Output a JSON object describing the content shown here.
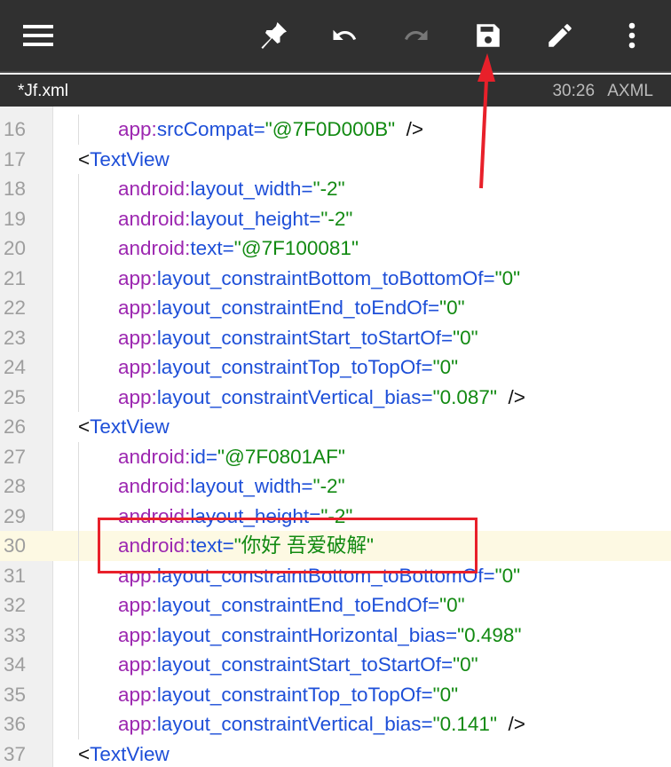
{
  "toolbar": {
    "icons": [
      "menu-icon",
      "pin-icon",
      "undo-icon",
      "redo-icon",
      "save-icon",
      "edit-icon",
      "more-vert-icon"
    ],
    "redo_enabled": false
  },
  "tab": {
    "name": "*Jf.xml",
    "cursor": "30:26",
    "mode": "AXML"
  },
  "colors": {
    "toolbar": "#303030",
    "prefix": "#9c27b0",
    "name": "#1e4fd8",
    "value": "#128a12",
    "highlight": "#fdf9e3",
    "annotation": "#e8202a"
  },
  "lines": [
    {
      "n": "16",
      "t": "attr",
      "p": "app",
      "a": "srcCompat",
      "v": "@7F0D000B",
      "close": true
    },
    {
      "n": "17",
      "t": "tag",
      "tag": "TextView"
    },
    {
      "n": "18",
      "t": "attr",
      "p": "android",
      "a": "layout_width",
      "v": "-2"
    },
    {
      "n": "19",
      "t": "attr",
      "p": "android",
      "a": "layout_height",
      "v": "-2"
    },
    {
      "n": "20",
      "t": "attr",
      "p": "android",
      "a": "text",
      "v": "@7F100081"
    },
    {
      "n": "21",
      "t": "attr",
      "p": "app",
      "a": "layout_constraintBottom_toBottomOf",
      "v": "0"
    },
    {
      "n": "22",
      "t": "attr",
      "p": "app",
      "a": "layout_constraintEnd_toEndOf",
      "v": "0"
    },
    {
      "n": "23",
      "t": "attr",
      "p": "app",
      "a": "layout_constraintStart_toStartOf",
      "v": "0"
    },
    {
      "n": "24",
      "t": "attr",
      "p": "app",
      "a": "layout_constraintTop_toTopOf",
      "v": "0"
    },
    {
      "n": "25",
      "t": "attr",
      "p": "app",
      "a": "layout_constraintVertical_bias",
      "v": "0.087",
      "close": true
    },
    {
      "n": "26",
      "t": "tag",
      "tag": "TextView"
    },
    {
      "n": "27",
      "t": "attr",
      "p": "android",
      "a": "id",
      "v": "@7F0801AF"
    },
    {
      "n": "28",
      "t": "attr",
      "p": "android",
      "a": "layout_width",
      "v": "-2"
    },
    {
      "n": "29",
      "t": "attr",
      "p": "android",
      "a": "layout_height",
      "v": "-2"
    },
    {
      "n": "30",
      "t": "attr",
      "p": "android",
      "a": "text",
      "v": "你好 吾爱破解",
      "hl": true
    },
    {
      "n": "31",
      "t": "attr",
      "p": "app",
      "a": "layout_constraintBottom_toBottomOf",
      "v": "0"
    },
    {
      "n": "32",
      "t": "attr",
      "p": "app",
      "a": "layout_constraintEnd_toEndOf",
      "v": "0"
    },
    {
      "n": "33",
      "t": "attr",
      "p": "app",
      "a": "layout_constraintHorizontal_bias",
      "v": "0.498"
    },
    {
      "n": "34",
      "t": "attr",
      "p": "app",
      "a": "layout_constraintStart_toStartOf",
      "v": "0"
    },
    {
      "n": "35",
      "t": "attr",
      "p": "app",
      "a": "layout_constraintTop_toTopOf",
      "v": "0"
    },
    {
      "n": "36",
      "t": "attr",
      "p": "app",
      "a": "layout_constraintVertical_bias",
      "v": "0.141",
      "close": true
    },
    {
      "n": "37",
      "t": "tag",
      "tag": "TextView"
    }
  ]
}
